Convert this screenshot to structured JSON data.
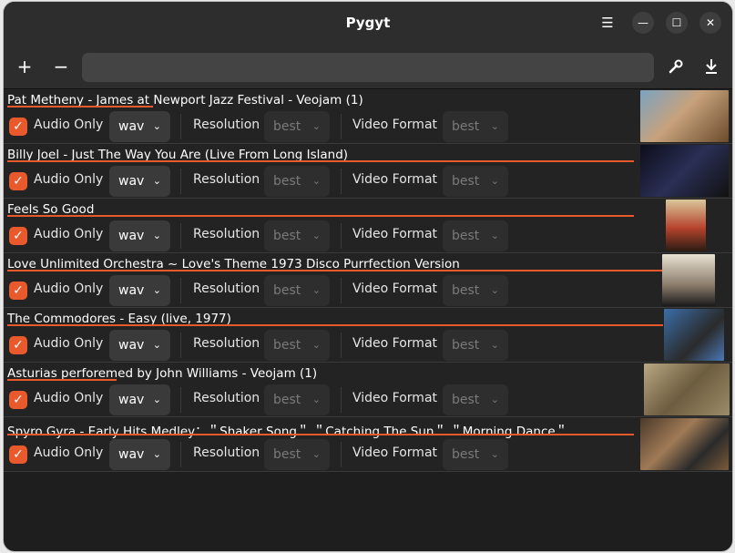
{
  "window": {
    "title": "Pygyt"
  },
  "titlebar": {
    "menu_icon": "menu-icon",
    "min_glyph": "—",
    "max_glyph": "☐",
    "close_glyph": "✕"
  },
  "toolbar": {
    "add_glyph": "+",
    "remove_glyph": "−",
    "url_value": "",
    "url_placeholder": "",
    "settings_glyph": "🔧",
    "download_glyph": "⤓"
  },
  "labels": {
    "audio_only": "Audio Only",
    "resolution": "Resolution",
    "video_format": "Video Format"
  },
  "colors": {
    "accent": "#e8592b"
  },
  "items": [
    {
      "title": "Pat Metheny - James at Newport Jazz Festival - Veojam (1)",
      "audio_only": true,
      "audio_format": "wav",
      "resolution": "best",
      "video_format": "best",
      "progress": 0.2
    },
    {
      "title": "Billy Joel - Just The Way You Are (Live From Long Island)",
      "audio_only": true,
      "audio_format": "wav",
      "resolution": "best",
      "video_format": "best",
      "progress": 0.86
    },
    {
      "title": "Feels So Good",
      "audio_only": true,
      "audio_format": "wav",
      "resolution": "best",
      "video_format": "best",
      "progress": 0.86
    },
    {
      "title": "Love Unlimited Orchestra ~ Love's Theme 1973 Disco Purrfection Version",
      "audio_only": true,
      "audio_format": "wav",
      "resolution": "best",
      "video_format": "best",
      "progress": 0.9
    },
    {
      "title": "The Commodores - Easy (live, 1977)",
      "audio_only": true,
      "audio_format": "wav",
      "resolution": "best",
      "video_format": "best",
      "progress": 0.9
    },
    {
      "title": "Asturias perforemed by John Williams - Veojam (1)",
      "audio_only": true,
      "audio_format": "wav",
      "resolution": "best",
      "video_format": "best",
      "progress": 0.15
    },
    {
      "title": "Spyro Gyra - Early Hits Medley：＂Shaker Song＂ ＂Catching The Sun＂ ＂Morning Dance＂",
      "audio_only": true,
      "audio_format": "wav",
      "resolution": "best",
      "video_format": "best",
      "progress": 0.86
    }
  ]
}
